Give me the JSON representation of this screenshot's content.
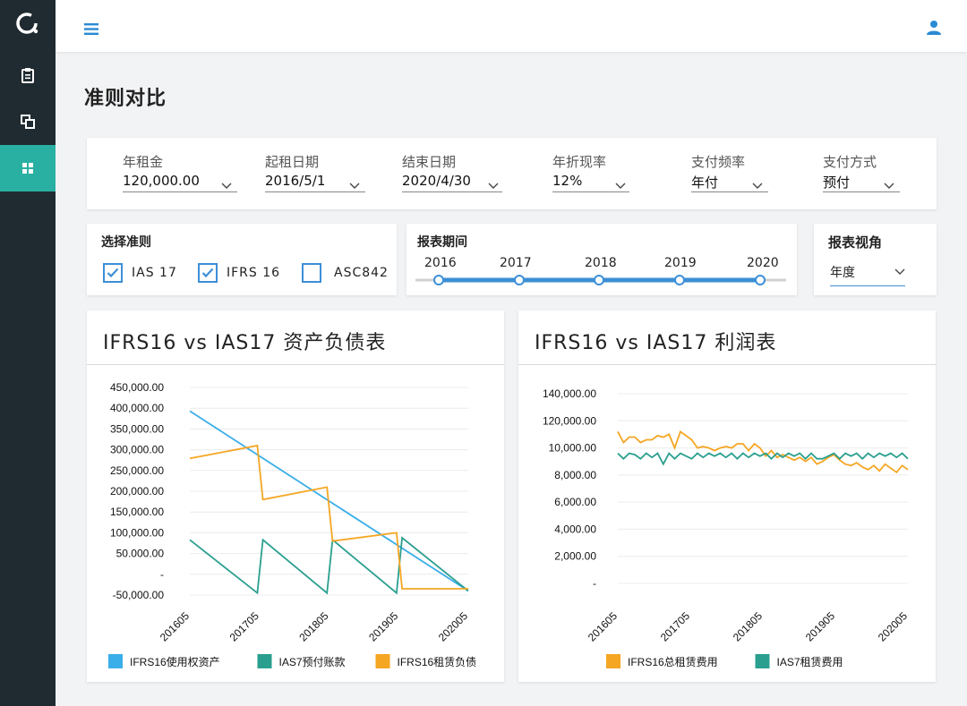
{
  "page_title": "准则对比",
  "params": [
    {
      "label": "年租金",
      "value": "120,000.00"
    },
    {
      "label": "起租日期",
      "value": "2016/5/1"
    },
    {
      "label": "结束日期",
      "value": "2020/4/30"
    },
    {
      "label": "年折现率",
      "value": "12%"
    },
    {
      "label": "支付频率",
      "value": "年付"
    },
    {
      "label": "支付方式",
      "value": "预付"
    }
  ],
  "standards": {
    "title": "选择准则",
    "options": [
      {
        "label": "IAS 17",
        "checked": true
      },
      {
        "label": "IFRS 16",
        "checked": true
      },
      {
        "label": "ASC842",
        "checked": false
      }
    ]
  },
  "period": {
    "title": "报表期间",
    "years": [
      "2016",
      "2017",
      "2018",
      "2019",
      "2020"
    ]
  },
  "view": {
    "title": "报表视角",
    "value": "年度"
  },
  "colors": {
    "accent": "#2ab0a3",
    "blue": "#3aaee8",
    "teal": "#2b9f8f",
    "orange": "#f5a623",
    "slider": "#3d8fd6"
  },
  "chart_data": [
    {
      "type": "line",
      "title": "IFRS16 vs IAS17 资产负债表",
      "ytick_labels": [
        "450,000.00",
        "400,000.00",
        "350,000.00",
        "300,000.00",
        "250,000.00",
        "200,000.00",
        "150,000.00",
        "100,000.00",
        "50.000.00",
        "-",
        "-50,000.00"
      ],
      "ylim": [
        -50000,
        450000
      ],
      "categories": [
        "201605",
        "201705",
        "201805",
        "201905",
        "202005"
      ],
      "series": [
        {
          "name": "IFRS16使用权资产",
          "color": "#3aaee8",
          "x": [
            0,
            4
          ],
          "y": [
            393000,
            -40000
          ]
        },
        {
          "name": "IAS7预付账款",
          "color": "#2b9f8f",
          "x": [
            0,
            0.97,
            1.05,
            1.97,
            2.05,
            2.97,
            3.05,
            4
          ],
          "y": [
            83000,
            -45000,
            83000,
            -45000,
            83000,
            -45000,
            88000,
            -40000
          ]
        },
        {
          "name": "IFRS16租赁负债",
          "color": "#f5a623",
          "x": [
            0,
            0.97,
            1.05,
            1.97,
            2.05,
            2.97,
            3.05,
            4
          ],
          "y": [
            279000,
            310000,
            180000,
            210000,
            80000,
            100000,
            -35000,
            -35000
          ]
        }
      ]
    },
    {
      "type": "line",
      "title": "IFRS16 vs IAS17 利润表",
      "ytick_labels": [
        "140,000.00",
        "120,000.00",
        "10,000.00",
        "8,000.00",
        "6,000.00",
        "4,000.00",
        "2,000.00",
        "-"
      ],
      "categories": [
        "201605",
        "201705",
        "201805",
        "201905",
        "202005"
      ],
      "series": [
        {
          "name": "IFRS16总租赁费用",
          "color": "#f5a623",
          "y": [
            112000,
            104000,
            108000,
            108000,
            104000,
            106000,
            106000,
            109000,
            108000,
            110000,
            100000,
            112000,
            109000,
            106000,
            100000,
            101000,
            100000,
            98000,
            100000,
            101000,
            100000,
            103000,
            103000,
            98000,
            103000,
            100000,
            94000,
            98000,
            93000,
            95000,
            93000,
            91000,
            93000,
            90000,
            93000,
            88000,
            90000,
            93000,
            95000,
            91000,
            88000,
            87000,
            89000,
            86000,
            84000,
            87000,
            83000,
            88000,
            85000,
            82000,
            87000,
            84000
          ]
        },
        {
          "name": "IAS7租赁费用",
          "color": "#2b9f8f",
          "y": [
            96000,
            92000,
            96000,
            95000,
            92000,
            96000,
            93000,
            96000,
            88000,
            96000,
            92000,
            96000,
            94000,
            92000,
            96000,
            93000,
            96000,
            94000,
            96000,
            93000,
            96000,
            92000,
            96000,
            93000,
            96000,
            94000,
            96000,
            92000,
            96000,
            93000,
            96000,
            94000,
            96000,
            92000,
            96000,
            92000,
            92000,
            94000,
            96000,
            92000,
            96000,
            94000,
            96000,
            92000,
            96000,
            93000,
            96000,
            94000,
            96000,
            93000,
            96000,
            92000
          ]
        }
      ]
    }
  ]
}
